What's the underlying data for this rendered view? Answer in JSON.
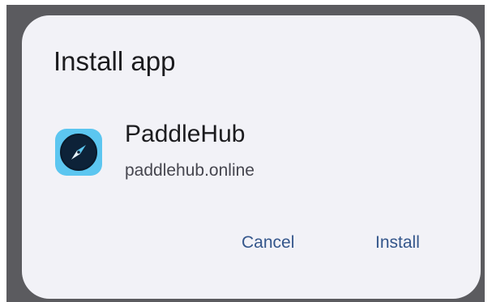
{
  "dialog": {
    "title": "Install app",
    "app": {
      "icon": "compass-icon",
      "icon_color": "#5cc6f0",
      "name": "PaddleHub",
      "domain": "paddlehub.online"
    },
    "actions": {
      "cancel_label": "Cancel",
      "install_label": "Install",
      "accent_color": "#34568b"
    }
  }
}
